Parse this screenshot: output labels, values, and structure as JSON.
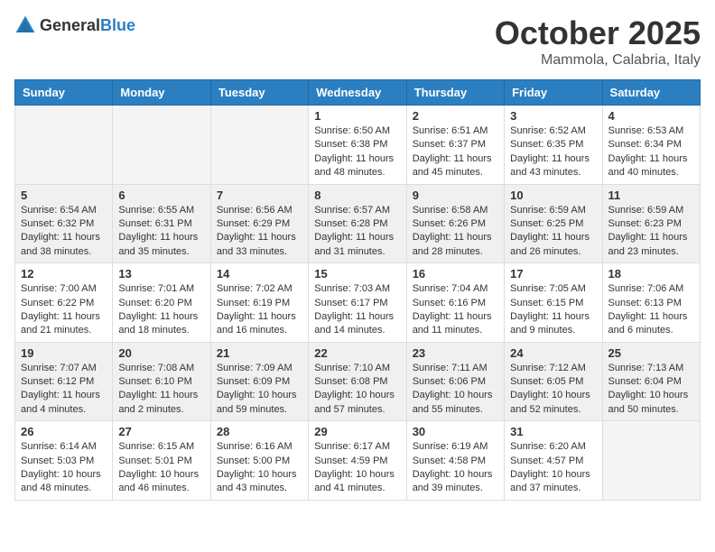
{
  "header": {
    "logo_general": "General",
    "logo_blue": "Blue",
    "month_title": "October 2025",
    "location": "Mammola, Calabria, Italy"
  },
  "days_of_week": [
    "Sunday",
    "Monday",
    "Tuesday",
    "Wednesday",
    "Thursday",
    "Friday",
    "Saturday"
  ],
  "weeks": [
    [
      {
        "day": "",
        "info": ""
      },
      {
        "day": "",
        "info": ""
      },
      {
        "day": "",
        "info": ""
      },
      {
        "day": "1",
        "info": "Sunrise: 6:50 AM\nSunset: 6:38 PM\nDaylight: 11 hours and 48 minutes."
      },
      {
        "day": "2",
        "info": "Sunrise: 6:51 AM\nSunset: 6:37 PM\nDaylight: 11 hours and 45 minutes."
      },
      {
        "day": "3",
        "info": "Sunrise: 6:52 AM\nSunset: 6:35 PM\nDaylight: 11 hours and 43 minutes."
      },
      {
        "day": "4",
        "info": "Sunrise: 6:53 AM\nSunset: 6:34 PM\nDaylight: 11 hours and 40 minutes."
      }
    ],
    [
      {
        "day": "5",
        "info": "Sunrise: 6:54 AM\nSunset: 6:32 PM\nDaylight: 11 hours and 38 minutes."
      },
      {
        "day": "6",
        "info": "Sunrise: 6:55 AM\nSunset: 6:31 PM\nDaylight: 11 hours and 35 minutes."
      },
      {
        "day": "7",
        "info": "Sunrise: 6:56 AM\nSunset: 6:29 PM\nDaylight: 11 hours and 33 minutes."
      },
      {
        "day": "8",
        "info": "Sunrise: 6:57 AM\nSunset: 6:28 PM\nDaylight: 11 hours and 31 minutes."
      },
      {
        "day": "9",
        "info": "Sunrise: 6:58 AM\nSunset: 6:26 PM\nDaylight: 11 hours and 28 minutes."
      },
      {
        "day": "10",
        "info": "Sunrise: 6:59 AM\nSunset: 6:25 PM\nDaylight: 11 hours and 26 minutes."
      },
      {
        "day": "11",
        "info": "Sunrise: 6:59 AM\nSunset: 6:23 PM\nDaylight: 11 hours and 23 minutes."
      }
    ],
    [
      {
        "day": "12",
        "info": "Sunrise: 7:00 AM\nSunset: 6:22 PM\nDaylight: 11 hours and 21 minutes."
      },
      {
        "day": "13",
        "info": "Sunrise: 7:01 AM\nSunset: 6:20 PM\nDaylight: 11 hours and 18 minutes."
      },
      {
        "day": "14",
        "info": "Sunrise: 7:02 AM\nSunset: 6:19 PM\nDaylight: 11 hours and 16 minutes."
      },
      {
        "day": "15",
        "info": "Sunrise: 7:03 AM\nSunset: 6:17 PM\nDaylight: 11 hours and 14 minutes."
      },
      {
        "day": "16",
        "info": "Sunrise: 7:04 AM\nSunset: 6:16 PM\nDaylight: 11 hours and 11 minutes."
      },
      {
        "day": "17",
        "info": "Sunrise: 7:05 AM\nSunset: 6:15 PM\nDaylight: 11 hours and 9 minutes."
      },
      {
        "day": "18",
        "info": "Sunrise: 7:06 AM\nSunset: 6:13 PM\nDaylight: 11 hours and 6 minutes."
      }
    ],
    [
      {
        "day": "19",
        "info": "Sunrise: 7:07 AM\nSunset: 6:12 PM\nDaylight: 11 hours and 4 minutes."
      },
      {
        "day": "20",
        "info": "Sunrise: 7:08 AM\nSunset: 6:10 PM\nDaylight: 11 hours and 2 minutes."
      },
      {
        "day": "21",
        "info": "Sunrise: 7:09 AM\nSunset: 6:09 PM\nDaylight: 10 hours and 59 minutes."
      },
      {
        "day": "22",
        "info": "Sunrise: 7:10 AM\nSunset: 6:08 PM\nDaylight: 10 hours and 57 minutes."
      },
      {
        "day": "23",
        "info": "Sunrise: 7:11 AM\nSunset: 6:06 PM\nDaylight: 10 hours and 55 minutes."
      },
      {
        "day": "24",
        "info": "Sunrise: 7:12 AM\nSunset: 6:05 PM\nDaylight: 10 hours and 52 minutes."
      },
      {
        "day": "25",
        "info": "Sunrise: 7:13 AM\nSunset: 6:04 PM\nDaylight: 10 hours and 50 minutes."
      }
    ],
    [
      {
        "day": "26",
        "info": "Sunrise: 6:14 AM\nSunset: 5:03 PM\nDaylight: 10 hours and 48 minutes."
      },
      {
        "day": "27",
        "info": "Sunrise: 6:15 AM\nSunset: 5:01 PM\nDaylight: 10 hours and 46 minutes."
      },
      {
        "day": "28",
        "info": "Sunrise: 6:16 AM\nSunset: 5:00 PM\nDaylight: 10 hours and 43 minutes."
      },
      {
        "day": "29",
        "info": "Sunrise: 6:17 AM\nSunset: 4:59 PM\nDaylight: 10 hours and 41 minutes."
      },
      {
        "day": "30",
        "info": "Sunrise: 6:19 AM\nSunset: 4:58 PM\nDaylight: 10 hours and 39 minutes."
      },
      {
        "day": "31",
        "info": "Sunrise: 6:20 AM\nSunset: 4:57 PM\nDaylight: 10 hours and 37 minutes."
      },
      {
        "day": "",
        "info": ""
      }
    ]
  ]
}
